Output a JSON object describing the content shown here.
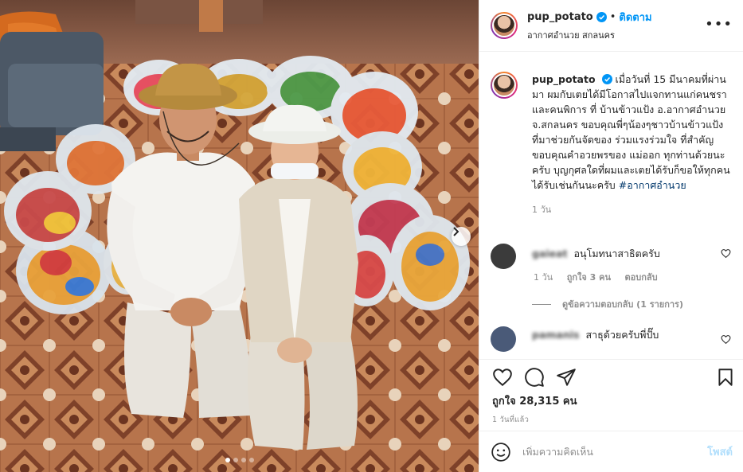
{
  "post": {
    "username": "pup_potato",
    "follow_label": "ติดตาม",
    "separator": "•",
    "location": "อากาศอำนวย สกลนคร",
    "more_label": "•••"
  },
  "caption": {
    "username": "pup_potato",
    "text": "เมื่อวันที่ 15 มีนาคมที่ผ่านมา ผมกับเตยได้มีโอกาสไปแจกทานแก่คนชรา และคนพิการ ที่ บ้านข้าวแป้ง อ.อากาศอำนวย จ.สกลนคร ขอบคุณพี่ๆน้องๆชาวบ้านข้าวแป้ง ที่มาช่วยกันจัดของ ร่วมแรงร่วมใจ ที่สำคัญขอบคุณคำอวยพรของ แม่ออก ทุกท่านด้วยนะครับ บุญกุศลใดที่ผมและเตยได้รับก็ขอให้ทุกคนได้รับเช่นกันนะครับ",
    "hashtag": "#อากาศอำนวย",
    "time": "1 วัน"
  },
  "comments": [
    {
      "username": "gaieat",
      "text": "อนุโมทนาสาธิตครับ",
      "time": "1 วัน",
      "likes": "ถูกใจ 3 คน",
      "reply_label": "ตอบกลับ",
      "view_replies": "ดูข้อความตอบกลับ (1 รายการ)",
      "avatar_color": "#3b3b3b"
    },
    {
      "username": "pamanis",
      "text": "สาธุด้วยครับพี่ปั๊บ",
      "avatar_color": "#4a5a78"
    }
  ],
  "footer": {
    "likes": "ถูกใจ 28,315 คน",
    "posted_ago": "1 วันที่แล้ว",
    "comment_placeholder": "เพิ่มความคิดเห็น",
    "post_label": "โพสต์"
  },
  "carousel": {
    "total": 4,
    "active": 1
  },
  "colors": {
    "accent": "#0095f6",
    "hashtag": "#00376b",
    "muted": "#8e8e8e",
    "post_disabled": "#b2dffc"
  }
}
